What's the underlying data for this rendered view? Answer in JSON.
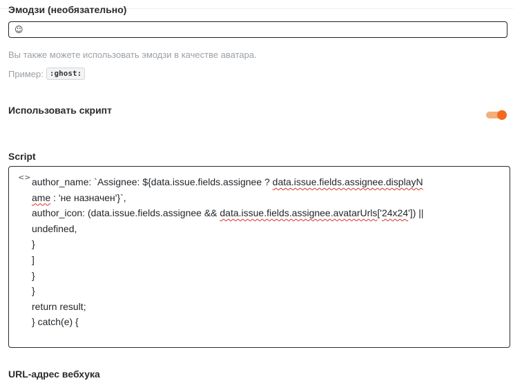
{
  "emoji_field": {
    "label": "Эмодзи (необязательно)",
    "value": "☺"
  },
  "emoji_hint": {
    "line1": "Вы также можете использовать эмодзи в качестве аватара.",
    "example_prefix": "Пример:",
    "example_code": ":ghost:"
  },
  "use_script": {
    "label": "Использовать скрипт",
    "enabled": true,
    "accent_color": "#f26b1d"
  },
  "script": {
    "label": "Script",
    "icon": "code-icon",
    "lines": [
      "author_name: `Assignee: ${data.issue.fields.assignee ? data.issue.fields.assignee.displayN",
      "ame : 'не назначен'}`,",
      "author_icon: (data.issue.fields.assignee && data.issue.fields.assignee.avatarUrls['24x24']) ||",
      "undefined,",
      "}",
      "]",
      "}",
      "}",
      "return result;",
      "} catch(e) {"
    ]
  },
  "webhook": {
    "label": "URL-адрес вебхука"
  }
}
